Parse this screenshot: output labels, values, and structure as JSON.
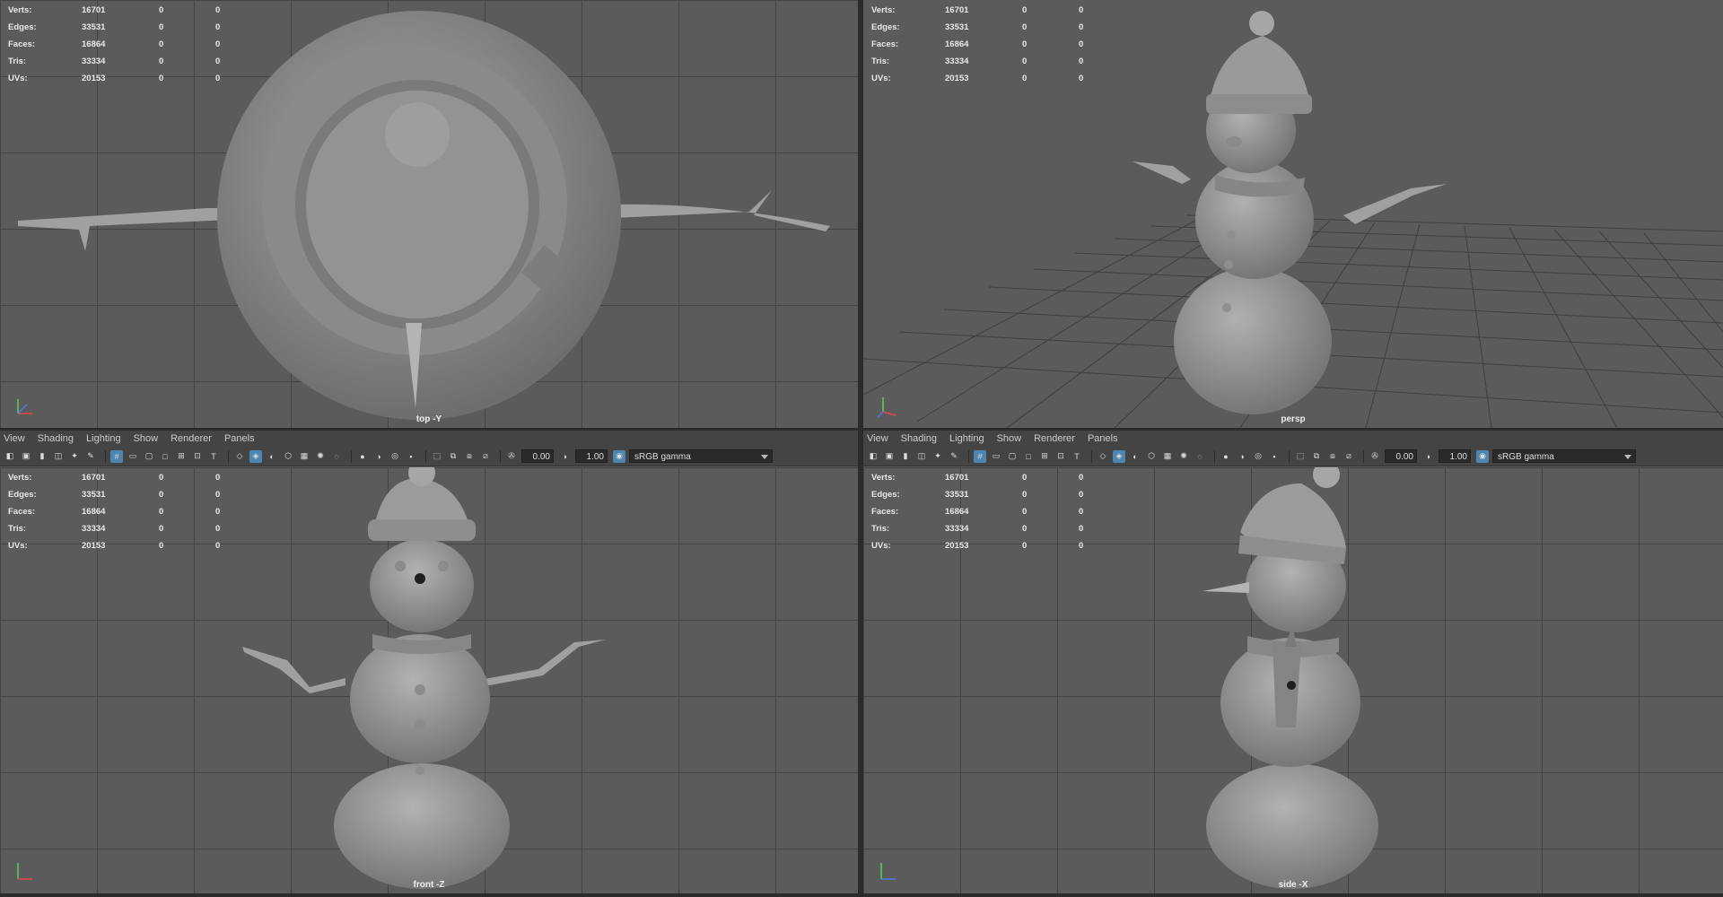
{
  "menu": [
    "View",
    "Shading",
    "Lighting",
    "Show",
    "Renderer",
    "Panels"
  ],
  "toolbar": {
    "exposure": "0.00",
    "gamma": "1.00",
    "color_space": "sRGB gamma"
  },
  "stats": [
    {
      "label": "Verts:",
      "v1": "16701",
      "v2": "0",
      "v3": "0"
    },
    {
      "label": "Edges:",
      "v1": "33531",
      "v2": "0",
      "v3": "0"
    },
    {
      "label": "Faces:",
      "v1": "16864",
      "v2": "0",
      "v3": "0"
    },
    {
      "label": "Tris:",
      "v1": "33334",
      "v2": "0",
      "v3": "0"
    },
    {
      "label": "UVs:",
      "v1": "20153",
      "v2": "0",
      "v3": "0"
    }
  ],
  "panes": {
    "top": {
      "camera": "top -Y"
    },
    "persp": {
      "camera": "persp"
    },
    "front": {
      "camera": "front -Z"
    },
    "side": {
      "camera": "side -X"
    }
  },
  "colors": {
    "viewport_bg": "#5b5b5b",
    "grid": "#3d3d3d",
    "menubar": "#444444",
    "highlight": "#4d86b0",
    "model": "#9a9a9a"
  }
}
